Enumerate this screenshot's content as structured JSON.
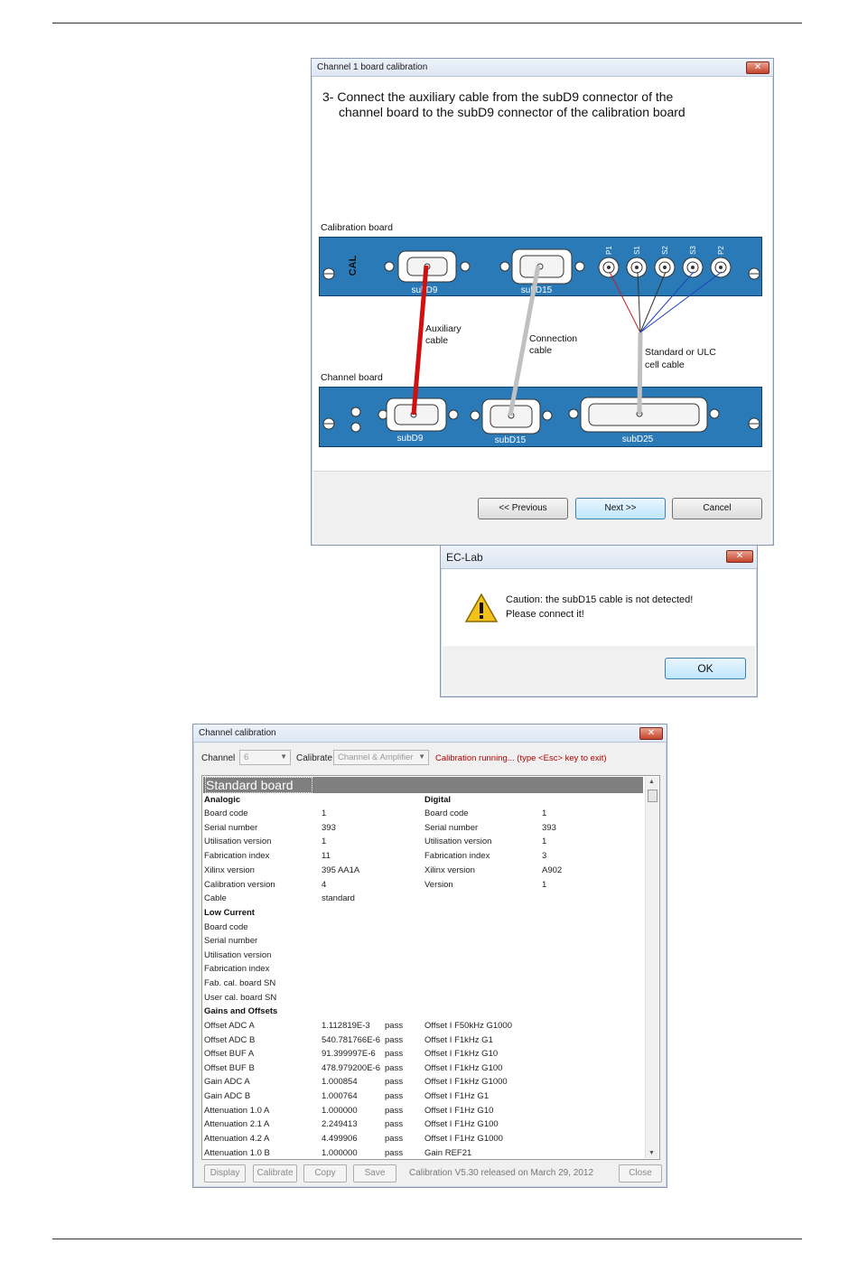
{
  "wizard": {
    "title": "Channel 1 board calibration",
    "close_label": "✕",
    "step_line1": "3- Connect the auxiliary cable from the subD9 connector of the",
    "step_line2": "channel board to the subD9 connector of the calibration board",
    "calibration_board_label": "Calibration board",
    "channel_board_label": "Channel board",
    "cal_logo": "CAL",
    "cal_connectors": [
      "subD9",
      "subD15"
    ],
    "cell_pins": [
      "P1",
      "S1",
      "S2",
      "S3",
      "P2"
    ],
    "channel_connectors": [
      "subD9",
      "subD15",
      "subD25"
    ],
    "cables": {
      "auxiliary_line1": "Auxiliary",
      "auxiliary_line2": "cable",
      "connection_line1": "Connection",
      "connection_line2": "cable",
      "cell_line1": "Standard or ULC",
      "cell_line2": "cell cable"
    },
    "colors": {
      "board": "#2a7ab8",
      "aux_cable": "#d01010",
      "conn_cable": "#c0c0c0"
    },
    "buttons": {
      "previous": "<< Previous",
      "next": "Next >>",
      "cancel": "Cancel"
    }
  },
  "eclab": {
    "title": "EC-Lab",
    "close_label": "✕",
    "icon": "warning-icon",
    "message_line1": "Caution: the subD15 cable is not detected!",
    "message_line2": "Please connect it!",
    "ok_label": "OK"
  },
  "calib": {
    "title": "Channel calibration",
    "close_label": "✕",
    "channel_label": "Channel",
    "channel_value": "6",
    "calibrate_label": "Calibrate",
    "calibrate_value": "Channel & Amplifier",
    "status": "Calibration running... (type <Esc> key to exit)",
    "section_title": "Standard board",
    "analogic_header": "Analogic",
    "digital_header": "Digital",
    "analogic": [
      {
        "k": "Board code",
        "v": "1"
      },
      {
        "k": "Serial number",
        "v": "393"
      },
      {
        "k": "Utilisation version",
        "v": "1"
      },
      {
        "k": "Fabrication index",
        "v": "11"
      },
      {
        "k": "Xilinx version",
        "v": "395 AA1A"
      },
      {
        "k": "Calibration version",
        "v": "4"
      },
      {
        "k": "Cable",
        "v": "standard"
      }
    ],
    "digital": [
      {
        "k": "Board code",
        "v": "1"
      },
      {
        "k": "Serial number",
        "v": "393"
      },
      {
        "k": "Utilisation version",
        "v": "1"
      },
      {
        "k": "Fabrication index",
        "v": "3"
      },
      {
        "k": "Xilinx version",
        "v": "A902"
      },
      {
        "k": "Version",
        "v": "1"
      }
    ],
    "low_current_header": "Low Current",
    "low_current": [
      "Board code",
      "Serial number",
      "Utilisation version",
      "Fabrication index",
      "Fab. cal. board SN",
      "User cal. board SN"
    ],
    "gains_header": "Gains and Offsets",
    "gains": [
      {
        "k": "Offset ADC A",
        "v": "1.112819E-3",
        "s": "pass",
        "k2": "Offset I F50kHz G1000"
      },
      {
        "k": "Offset ADC B",
        "v": "540.781766E-6",
        "s": "pass",
        "k2": "Offset I F1kHz G1"
      },
      {
        "k": "Offset BUF A",
        "v": "91.399997E-6",
        "s": "pass",
        "k2": "Offset I F1kHz G10"
      },
      {
        "k": "Offset BUF B",
        "v": "478.979200E-6",
        "s": "pass",
        "k2": "Offset I F1kHz G100"
      },
      {
        "k": "Gain ADC A",
        "v": "1.000854",
        "s": "pass",
        "k2": "Offset I F1kHz G1000"
      },
      {
        "k": "Gain ADC B",
        "v": "1.000764",
        "s": "pass",
        "k2": "Offset I F1Hz G1"
      },
      {
        "k": "Attenuation 1.0 A",
        "v": "1.000000",
        "s": "pass",
        "k2": "Offset I F1Hz G10"
      },
      {
        "k": "Attenuation 2.1 A",
        "v": "2.249413",
        "s": "pass",
        "k2": "Offset I F1Hz G100"
      },
      {
        "k": "Attenuation 4.2 A",
        "v": "4.499906",
        "s": "pass",
        "k2": "Offset I F1Hz G1000"
      },
      {
        "k": "Attenuation 1.0 B",
        "v": "1.000000",
        "s": "pass",
        "k2": "Gain REF21"
      }
    ],
    "buttons": {
      "display": "Display",
      "calibrate": "Calibrate",
      "copy": "Copy",
      "save": "Save",
      "close": "Close"
    },
    "release": "Calibration V5.30 released on March 29, 2012"
  }
}
